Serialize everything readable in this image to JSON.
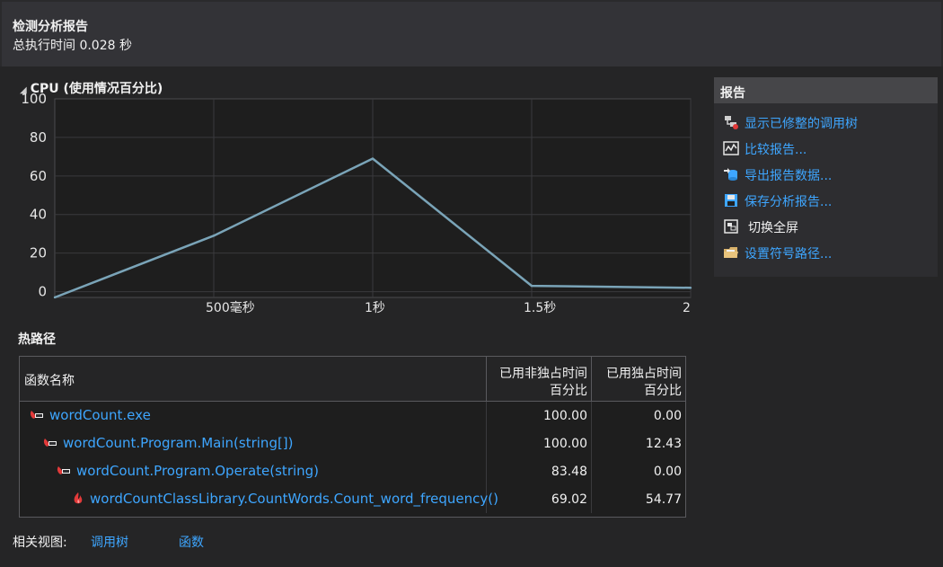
{
  "header": {
    "title": "检测分析报告",
    "exec_time": "总执行时间 0.028 秒"
  },
  "cpu_section": {
    "title": "CPU (使用情况百分比)"
  },
  "chart_data": {
    "type": "line",
    "title": "CPU (使用情况百分比)",
    "x": [
      0,
      0.5,
      1.0,
      1.5,
      2.0
    ],
    "y": [
      -3,
      29,
      69,
      3,
      2
    ],
    "xlim": [
      0,
      2.0
    ],
    "ylim": [
      -3,
      100
    ],
    "yticks": [
      0,
      20,
      40,
      60,
      80,
      100
    ],
    "xtick_values": [
      0.5,
      1.0,
      1.5,
      2.0
    ],
    "xtick_labels": [
      "500毫秒",
      "1秒",
      "1.5秒",
      "2"
    ],
    "grid": true,
    "line_color": "#7aa4b8"
  },
  "hot_path": {
    "title": "热路径",
    "columns": {
      "name": "函数名称",
      "inclusive_l1": "已用非独占时间",
      "inclusive_l2": "百分比",
      "exclusive_l1": "已用独占时间",
      "exclusive_l2": "百分比"
    },
    "rows": [
      {
        "name": "wordCount.exe",
        "inclusive": "100.00",
        "exclusive": "0.00",
        "icon": "hot-path-icon"
      },
      {
        "name": "wordCount.Program.Main(string[])",
        "inclusive": "100.00",
        "exclusive": "12.43",
        "icon": "hot-path-icon"
      },
      {
        "name": "wordCount.Program.Operate(string)",
        "inclusive": "83.48",
        "exclusive": "0.00",
        "icon": "hot-path-icon"
      },
      {
        "name": "wordCountClassLibrary.CountWords.Count_word_frequency()",
        "inclusive": "69.02",
        "exclusive": "54.77",
        "icon": "flame-icon"
      }
    ]
  },
  "related": {
    "label": "相关视图:",
    "call_tree": "调用树",
    "functions": "函数"
  },
  "report_panel": {
    "title": "报告",
    "actions": [
      {
        "label": "显示已修整的调用树",
        "icon": "call-tree-icon"
      },
      {
        "label": "比较报告...",
        "icon": "compare-icon"
      },
      {
        "label": "导出报告数据...",
        "icon": "export-icon"
      },
      {
        "label": "保存分析报告...",
        "icon": "save-icon"
      },
      {
        "label": "切换全屏",
        "icon": "fullscreen-icon"
      },
      {
        "label": "设置符号路径...",
        "icon": "folder-icon"
      }
    ]
  },
  "colors": {
    "background": "#252526",
    "header": "#333337",
    "link": "#3ea6ff",
    "chart_bg": "#1e1e1e",
    "chart_line": "#7aa4b8"
  }
}
